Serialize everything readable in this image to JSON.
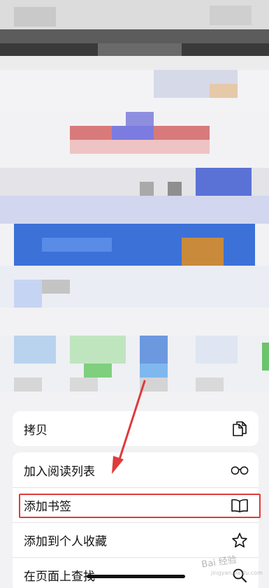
{
  "share_sheet": {
    "copy_group": {
      "copy_label": "拷贝",
      "copy_icon": "copy-icon"
    },
    "actions": [
      {
        "label": "加入阅读列表",
        "icon": "glasses-icon"
      },
      {
        "label": "添加书签",
        "icon": "book-icon"
      },
      {
        "label": "添加到个人收藏",
        "icon": "star-icon"
      },
      {
        "label": "在页面上查找",
        "icon": "search-icon"
      }
    ]
  },
  "annotation": {
    "highlighted_action": "添加书签",
    "color": "#e03a3a"
  },
  "watermark": {
    "text": "Bai 经验",
    "sub": "jingyan.baidu.com"
  }
}
